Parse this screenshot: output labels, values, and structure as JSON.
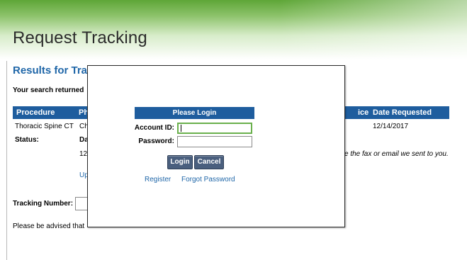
{
  "header": {
    "title": "Request Tracking"
  },
  "results": {
    "heading": "Results for Trac",
    "summary": "Your search returned"
  },
  "table": {
    "columns": {
      "procedure": "Procedure",
      "ph": "Ph",
      "service": "ice",
      "date_requested": "Date Requested"
    },
    "row": {
      "procedure": "Thoracic Spine CT",
      "ph_cell": "Ch",
      "date_requested": "12/14/2017"
    },
    "status_label": "Status:",
    "status_cell": "Da",
    "status_line2": "12",
    "note_right": "e the fax or email we sent to you.",
    "link_partial": "Up"
  },
  "tracking": {
    "label": "Tracking Number:",
    "value": ""
  },
  "advisory_text": "Please be advised that",
  "modal": {
    "header": "Please Login",
    "account_label": "Account ID:",
    "account_value": "",
    "password_label": "Password:",
    "password_value": "",
    "login_button": "Login",
    "cancel_button": "Cancel",
    "register_link": "Register",
    "forgot_link": "Forgot Password"
  },
  "colors": {
    "brand_green": "#5ea637",
    "header_blue": "#1e5d9e",
    "link_blue": "#1f66a8",
    "button": "#4a5f7e",
    "focus_green": "#6ab04c"
  }
}
